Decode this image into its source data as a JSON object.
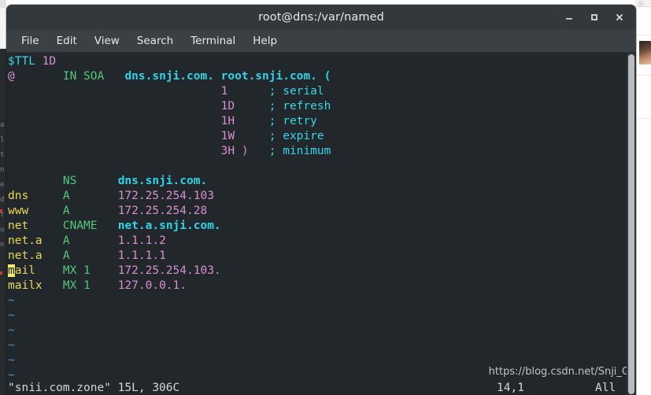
{
  "window": {
    "title": "root@dns:/var/named",
    "buttons": {
      "minimize": "minimize",
      "maximize": "maximize",
      "close": "close"
    }
  },
  "menubar": {
    "items": [
      {
        "label": "File"
      },
      {
        "label": "Edit"
      },
      {
        "label": "View"
      },
      {
        "label": "Search"
      },
      {
        "label": "Terminal"
      },
      {
        "label": "Help"
      }
    ]
  },
  "editor": {
    "lines": [
      {
        "segments": [
          {
            "text": "$TTL ",
            "style": "key"
          },
          {
            "text": "1D",
            "style": "num"
          }
        ]
      },
      {
        "segments": [
          {
            "text": "@",
            "style": "num"
          },
          {
            "text": "       ",
            "style": "plain"
          },
          {
            "text": "IN SOA",
            "style": "type"
          },
          {
            "text": "   ",
            "style": "plain"
          },
          {
            "text": "dns.snji.com. root.snji.com. (",
            "style": "domain"
          }
        ]
      },
      {
        "segments": [
          {
            "text": "                               ",
            "style": "plain"
          },
          {
            "text": "1",
            "style": "num"
          },
          {
            "text": "      ",
            "style": "plain"
          },
          {
            "text": "; serial",
            "style": "comment"
          }
        ]
      },
      {
        "segments": [
          {
            "text": "                               ",
            "style": "plain"
          },
          {
            "text": "1D",
            "style": "num"
          },
          {
            "text": "     ",
            "style": "plain"
          },
          {
            "text": "; refresh",
            "style": "comment"
          }
        ]
      },
      {
        "segments": [
          {
            "text": "                               ",
            "style": "plain"
          },
          {
            "text": "1H",
            "style": "num"
          },
          {
            "text": "     ",
            "style": "plain"
          },
          {
            "text": "; retry",
            "style": "comment"
          }
        ]
      },
      {
        "segments": [
          {
            "text": "                               ",
            "style": "plain"
          },
          {
            "text": "1W",
            "style": "num"
          },
          {
            "text": "     ",
            "style": "plain"
          },
          {
            "text": "; expire",
            "style": "comment"
          }
        ]
      },
      {
        "segments": [
          {
            "text": "                               ",
            "style": "plain"
          },
          {
            "text": "3H )",
            "style": "num"
          },
          {
            "text": "   ",
            "style": "plain"
          },
          {
            "text": "; minimum",
            "style": "comment"
          }
        ]
      },
      {
        "segments": [
          {
            "text": "",
            "style": "plain"
          }
        ]
      },
      {
        "segments": [
          {
            "text": "        ",
            "style": "plain"
          },
          {
            "text": "NS",
            "style": "type"
          },
          {
            "text": "      ",
            "style": "plain"
          },
          {
            "text": "dns.snji.com.",
            "style": "domain"
          }
        ]
      },
      {
        "segments": [
          {
            "text": "dns",
            "style": "host"
          },
          {
            "text": "     ",
            "style": "plain"
          },
          {
            "text": "A",
            "style": "type"
          },
          {
            "text": "       ",
            "style": "plain"
          },
          {
            "text": "172.25.254.103",
            "style": "num"
          }
        ]
      },
      {
        "segments": [
          {
            "text": "www",
            "style": "host"
          },
          {
            "text": "     ",
            "style": "plain"
          },
          {
            "text": "A",
            "style": "type"
          },
          {
            "text": "       ",
            "style": "plain"
          },
          {
            "text": "172.25.254.28",
            "style": "num"
          }
        ]
      },
      {
        "segments": [
          {
            "text": "net",
            "style": "host"
          },
          {
            "text": "     ",
            "style": "plain"
          },
          {
            "text": "CNAME",
            "style": "type"
          },
          {
            "text": "   ",
            "style": "plain"
          },
          {
            "text": "net.a.snji.com.",
            "style": "domain"
          }
        ]
      },
      {
        "segments": [
          {
            "text": "net.a",
            "style": "host"
          },
          {
            "text": "   ",
            "style": "plain"
          },
          {
            "text": "A",
            "style": "type"
          },
          {
            "text": "       ",
            "style": "plain"
          },
          {
            "text": "1.1.1.2",
            "style": "num"
          }
        ]
      },
      {
        "segments": [
          {
            "text": "net.a",
            "style": "host"
          },
          {
            "text": "   ",
            "style": "plain"
          },
          {
            "text": "A",
            "style": "type"
          },
          {
            "text": "       ",
            "style": "plain"
          },
          {
            "text": "1.1.1.1",
            "style": "num"
          }
        ]
      },
      {
        "segments": [
          {
            "text": "m",
            "style": "cursor"
          },
          {
            "text": "ail",
            "style": "host"
          },
          {
            "text": "    ",
            "style": "plain"
          },
          {
            "text": "MX 1",
            "style": "type"
          },
          {
            "text": "    ",
            "style": "plain"
          },
          {
            "text": "172.25.254.103.",
            "style": "num"
          }
        ]
      },
      {
        "segments": [
          {
            "text": "mailx",
            "style": "host"
          },
          {
            "text": "   ",
            "style": "plain"
          },
          {
            "text": "MX 1",
            "style": "type"
          },
          {
            "text": "    ",
            "style": "plain"
          },
          {
            "text": "127.0.0.1.",
            "style": "num"
          }
        ]
      },
      {
        "segments": [
          {
            "text": "~",
            "style": "tilde"
          }
        ]
      },
      {
        "segments": [
          {
            "text": "~",
            "style": "tilde"
          }
        ]
      },
      {
        "segments": [
          {
            "text": "~",
            "style": "tilde"
          }
        ]
      },
      {
        "segments": [
          {
            "text": "~",
            "style": "tilde"
          }
        ]
      },
      {
        "segments": [
          {
            "text": "~",
            "style": "tilde"
          }
        ]
      },
      {
        "segments": [
          {
            "text": "~",
            "style": "tilde"
          }
        ]
      },
      {
        "segments": [
          {
            "text": "~",
            "style": "tilde"
          }
        ]
      }
    ]
  },
  "statusline": {
    "file_info": "\"snii.com.zone\" 15L, 306C",
    "position": "14,1",
    "scroll": "All"
  },
  "watermark": {
    "text": "https://blog.csdn.net/Snji_G"
  },
  "colors": {
    "terminal_bg": "#22272b",
    "titlebar_bg": "#32383b",
    "menubar_bg": "#3a4044",
    "cyan": "#34d6e8",
    "magenta": "#d88fd0",
    "green": "#52c97a",
    "yellow": "#e6d858",
    "blue": "#4a8fd4",
    "cursor": "#f2e86a"
  }
}
